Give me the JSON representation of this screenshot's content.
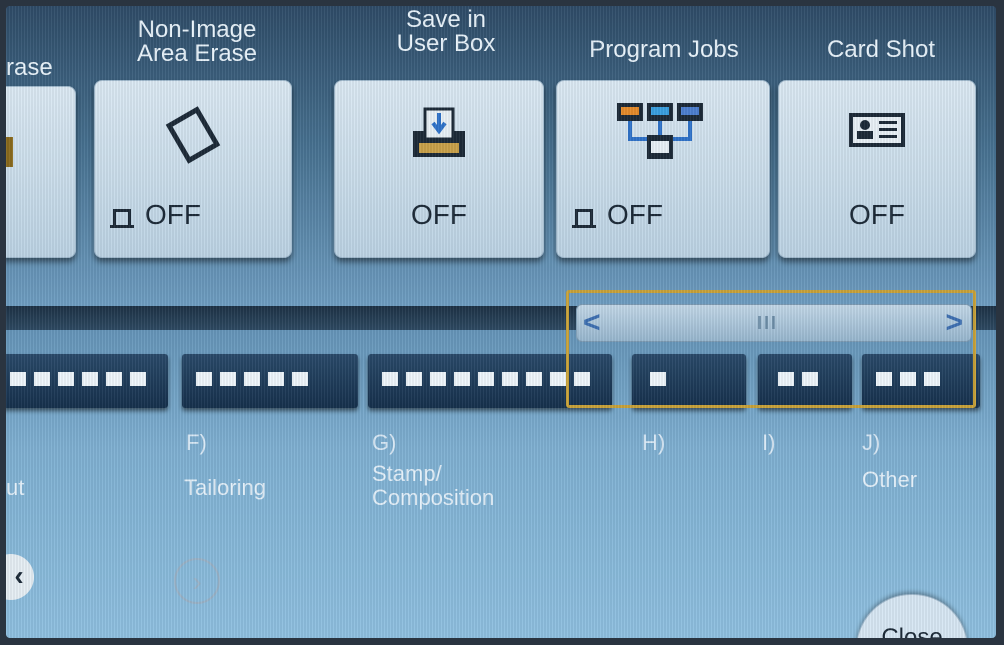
{
  "functions": [
    {
      "label": "rase",
      "state": ""
    },
    {
      "label": "Non-Image\nArea Erase",
      "state": "OFF"
    },
    {
      "label": "Save in\nUser Box",
      "state": "OFF"
    },
    {
      "label": "Program Jobs",
      "state": "OFF"
    },
    {
      "label": "Card Shot",
      "state": "OFF"
    }
  ],
  "tabs": [
    {
      "letter": "",
      "name": "ut"
    },
    {
      "letter": "F)",
      "name": "Tailoring"
    },
    {
      "letter": "G)",
      "name": "Stamp/\nComposition"
    },
    {
      "letter": "H)",
      "name": ""
    },
    {
      "letter": "I)",
      "name": ""
    },
    {
      "letter": "J)",
      "name": "Other"
    }
  ],
  "scrollbar": {
    "thumb": "III",
    "left_arrow": "<",
    "right_arrow": ">"
  },
  "close_label": "Close",
  "colors": {
    "highlight_border": "#c8a23a",
    "scroll_arrow": "#3d6fb1"
  }
}
